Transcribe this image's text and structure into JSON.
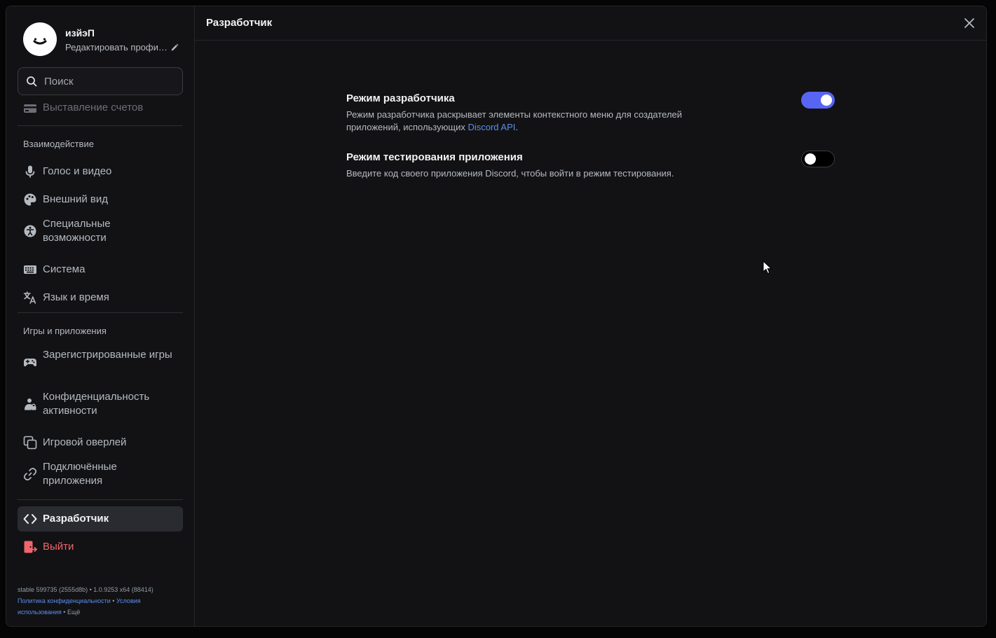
{
  "sidebar": {
    "profile": {
      "username": "изйэП",
      "edit_label": "Редактировать профиль"
    },
    "search": {
      "placeholder": "Поиск"
    },
    "billing_label": "Выставление счетов",
    "sections": [
      {
        "title": "Взаимодействие",
        "items": [
          {
            "label": "Голос и видео",
            "icon": "microphone-icon"
          },
          {
            "label": "Внешний вид",
            "icon": "palette-icon"
          },
          {
            "label": "Специальные возможности",
            "icon": "accessibility-icon"
          },
          {
            "label": "Система",
            "icon": "keyboard-icon"
          },
          {
            "label": "Язык и время",
            "icon": "language-icon"
          }
        ]
      },
      {
        "title": "Игры и приложения",
        "items": [
          {
            "label": "Зарегистрированные игры",
            "icon": "gamepad-icon"
          },
          {
            "label": "Конфиденциальность активности",
            "icon": "activity-privacy-icon"
          },
          {
            "label": "Игровой оверлей",
            "icon": "overlay-icon"
          },
          {
            "label": "Подключённые приложения",
            "icon": "link-icon"
          }
        ]
      }
    ],
    "developer_label": "Разработчик",
    "logout_label": "Выйти",
    "footer": {
      "build": "stable 599735 (2555d8b) • 1.0.9253 x64 (88414)",
      "privacy": "Политика конфиденциальности",
      "separator": "•",
      "terms": "Условия использования",
      "separator2": "•",
      "more": "Ещё"
    }
  },
  "header": {
    "title": "Разработчик"
  },
  "settings": [
    {
      "title": "Режим разработчика",
      "desc_before": "Режим разработчика раскрывает элементы контекстного меню для создателей приложений, использующих ",
      "desc_link": "Discord API",
      "desc_after": ".",
      "enabled": true
    },
    {
      "title": "Режим тестирования приложения",
      "desc": "Введите код своего приложения Discord, чтобы войти в режим тестирования.",
      "enabled": false
    }
  ],
  "colors": {
    "accent": "#5865f2",
    "danger": "#f0666c",
    "link": "#5b8ef0",
    "background": "#121214"
  }
}
